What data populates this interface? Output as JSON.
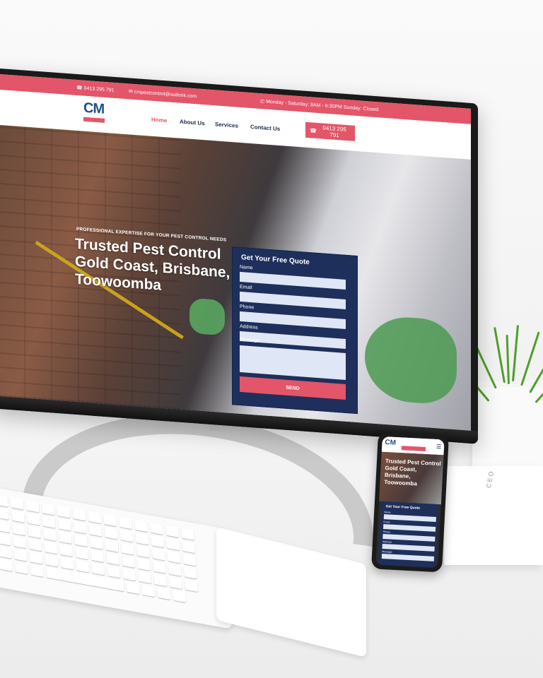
{
  "website": {
    "topbar": {
      "phone": "0413 295 791",
      "email": "cmpestcontrol@outlook.com",
      "hours": "Monday - Saturday: 8AM - 6:30PM Sunday: Closed"
    },
    "logo": "CM",
    "nav": {
      "items": [
        "Home",
        "About Us",
        "Services",
        "Contact Us"
      ],
      "active": "Home",
      "cta": "0413 295 791"
    },
    "hero": {
      "eyebrow": "PROFESSIONAL EXPERTISE FOR YOUR PEST CONTROL NEEDS",
      "headline": "Trusted Pest Control Gold Coast, Brisbane, Toowoomba"
    },
    "quote_form": {
      "title": "Get Your Free Quote",
      "labels": [
        "Name",
        "Email",
        "Phone",
        "Address",
        "Message"
      ],
      "submit": "SEND"
    }
  },
  "phone_view": {
    "logo": "CM",
    "headline": "Trusted Pest Control Gold Coast, Brisbane, Toowoomba",
    "form_title": "Get Your Free Quote",
    "labels": [
      "Name",
      "Email",
      "Phone",
      "Address",
      "Message"
    ]
  },
  "box_text": "CEO",
  "colors": {
    "accent": "#e35568",
    "navy": "#1e2f5c",
    "logo_blue": "#1f4f8f",
    "plant_green": "#4f9e2d"
  }
}
